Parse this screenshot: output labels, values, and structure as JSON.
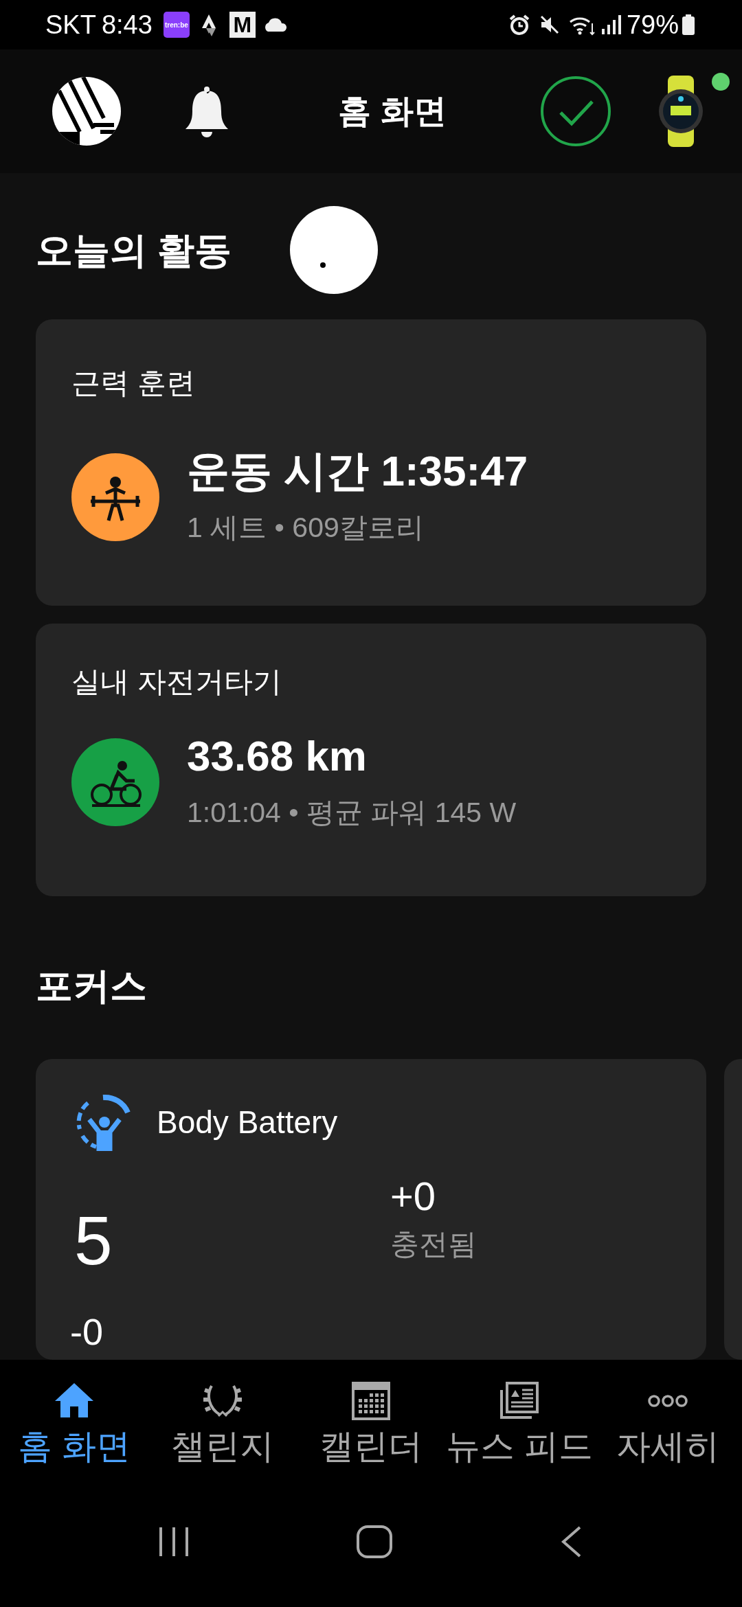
{
  "status_bar": {
    "carrier": "SKT",
    "time": "8:43",
    "app_badges": [
      "tren:be",
      "M"
    ],
    "battery": "79%"
  },
  "header": {
    "title": "홈 화면",
    "watch_connected": true
  },
  "activity": {
    "title": "오늘의 활동",
    "cards": [
      {
        "kind": "strength",
        "color": "#ff9a3c",
        "title": "근력 훈련",
        "main": "운동 시간 1:35:47",
        "detail": "1 세트 • 609칼로리"
      },
      {
        "kind": "cycling",
        "color": "#17a046",
        "title": "실내 자전거타기",
        "main": "33.68 km",
        "detail": "1:01:04 • 평균 파워 145 W"
      }
    ]
  },
  "focus": {
    "title": "포커스",
    "card": {
      "title": "Body Battery",
      "value": "5",
      "charged": "+0",
      "charged_label": "충전됨",
      "drained": "-0"
    }
  },
  "bottom_nav": [
    {
      "kind": "home",
      "label": "홈 화면",
      "selected": true
    },
    {
      "kind": "challenges",
      "label": "챌린지",
      "selected": false
    },
    {
      "kind": "calendar",
      "label": "캘린더",
      "selected": false
    },
    {
      "kind": "news",
      "label": "뉴스 피드",
      "selected": false
    },
    {
      "kind": "more",
      "label": "자세히",
      "selected": false
    }
  ]
}
